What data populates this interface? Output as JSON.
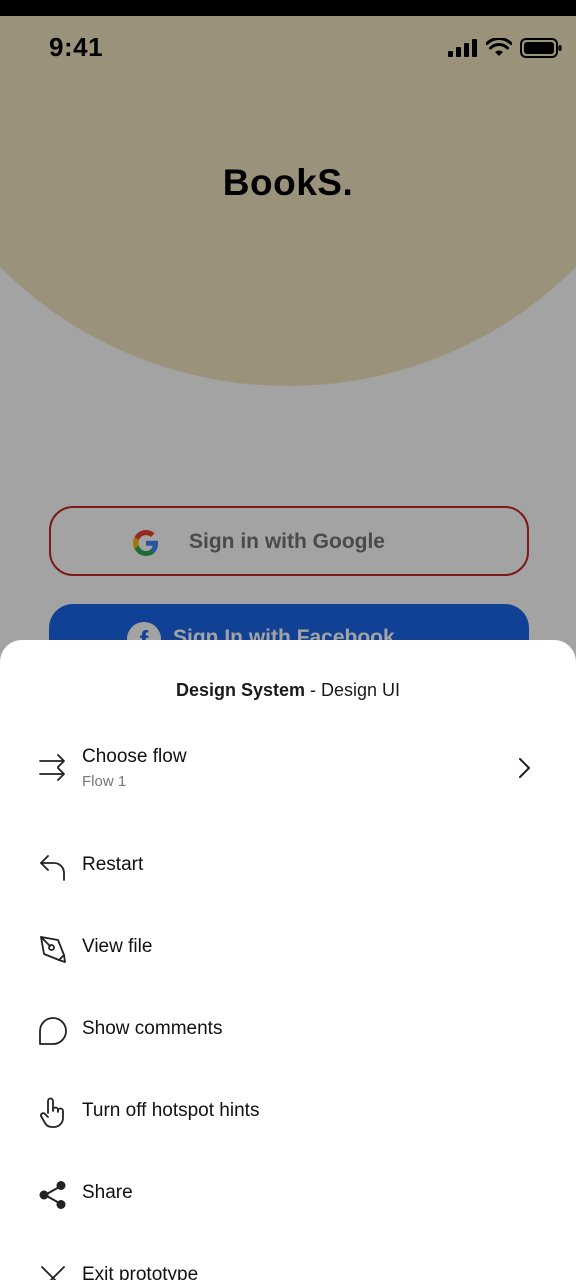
{
  "status_bar": {
    "time": "9:41",
    "icons": [
      "signal-icon",
      "wifi-icon",
      "battery-icon"
    ]
  },
  "app": {
    "logo": "BookS.",
    "hero_color": "#f2e5c3",
    "buttons": {
      "google": {
        "label": "Sign in with Google",
        "border_color": "#c62828",
        "icon": "google-icon"
      },
      "facebook": {
        "label": "Sign In with Facebook",
        "bg_color": "#1a66e8",
        "icon": "facebook-icon"
      }
    }
  },
  "sheet": {
    "title_bold": "Design System",
    "title_rest": " - Design UI",
    "items": [
      {
        "label": "Choose flow",
        "sublabel": "Flow 1",
        "icon": "arrows-right-icon",
        "chevron": true
      },
      {
        "label": "Restart",
        "icon": "restart-icon"
      },
      {
        "label": "View file",
        "icon": "pen-icon"
      },
      {
        "label": "Show comments",
        "icon": "comment-icon"
      },
      {
        "label": "Turn off hotspot hints",
        "icon": "hand-pointer-icon"
      },
      {
        "label": "Share",
        "icon": "share-icon"
      },
      {
        "label": "Exit prototype",
        "icon": "close-icon"
      }
    ]
  }
}
